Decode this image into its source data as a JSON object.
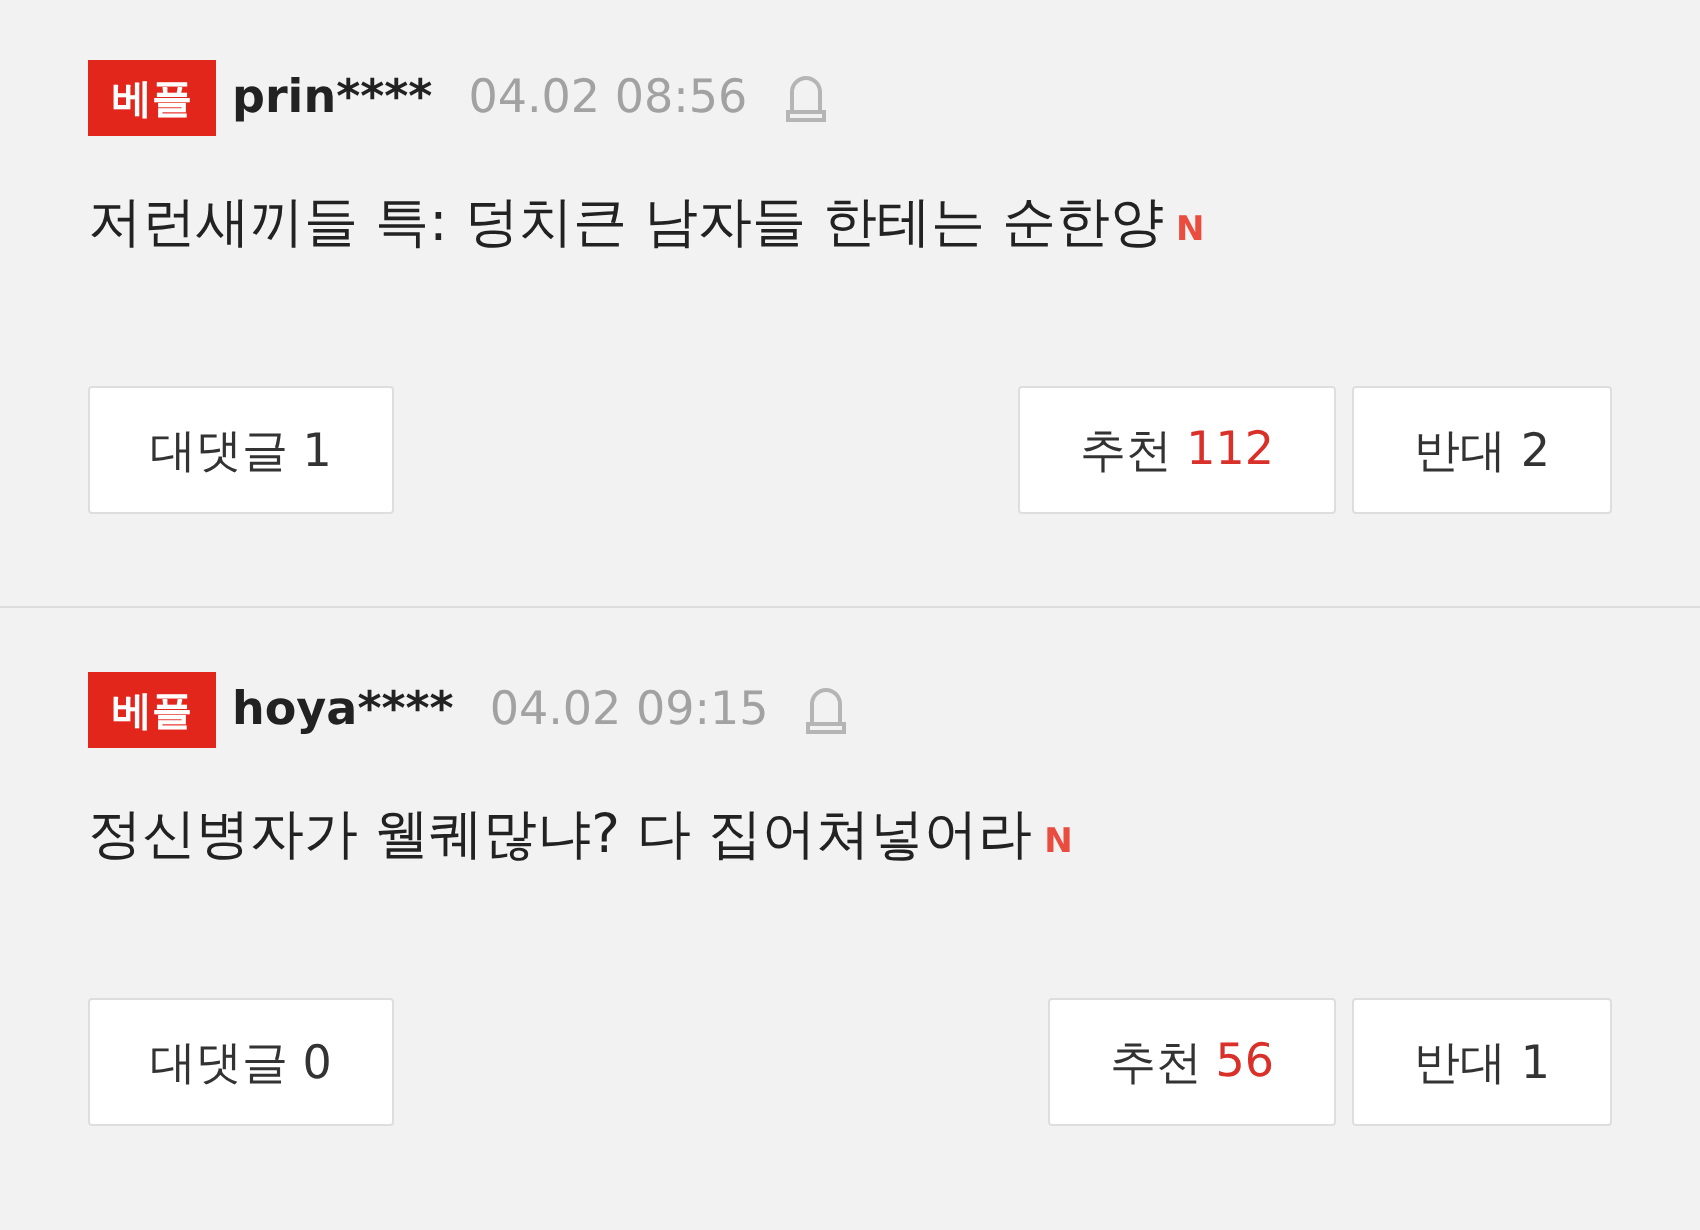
{
  "comments": [
    {
      "badge": "베플",
      "user": "prin****",
      "time": "04.02 08:56",
      "text": "저런새끼들 특: 덩치큰 남자들 한테는 순한양",
      "new_mark": "N",
      "reply_button": "대댓글 1",
      "like_label": "추천",
      "like_count": "112",
      "dislike_button": "반대 2"
    },
    {
      "badge": "베플",
      "user": "hoya****",
      "time": "04.02 09:15",
      "text": "정신병자가 웰퀘많냐? 다 집어쳐넣어라",
      "new_mark": "N",
      "reply_button": "대댓글 0",
      "like_label": "추천",
      "like_count": "56",
      "dislike_button": "반대 1"
    }
  ]
}
